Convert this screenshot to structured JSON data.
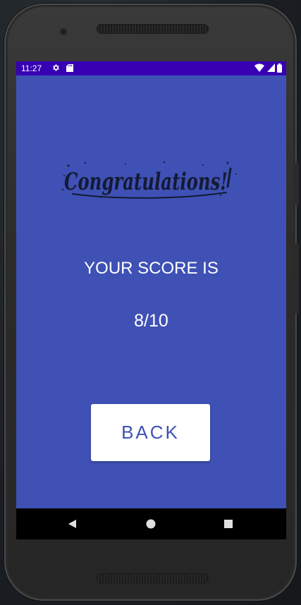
{
  "status_bar": {
    "time": "11:27",
    "icons_left": [
      "gear-icon",
      "sd-card-icon"
    ],
    "icons_right": [
      "wifi-icon",
      "signal-icon",
      "battery-icon"
    ]
  },
  "app": {
    "congrats_image_text": "Congratulations!",
    "score_label": "YOUR SCORE IS",
    "score_value": "8/10",
    "back_button_label": "BACK"
  },
  "nav_bar": {
    "buttons": [
      "back-triangle-icon",
      "home-circle-icon",
      "recents-square-icon"
    ]
  },
  "colors": {
    "primary": "#3f51b5",
    "status_bar": "#3700b3",
    "button_bg": "#ffffff",
    "text": "#ffffff"
  }
}
